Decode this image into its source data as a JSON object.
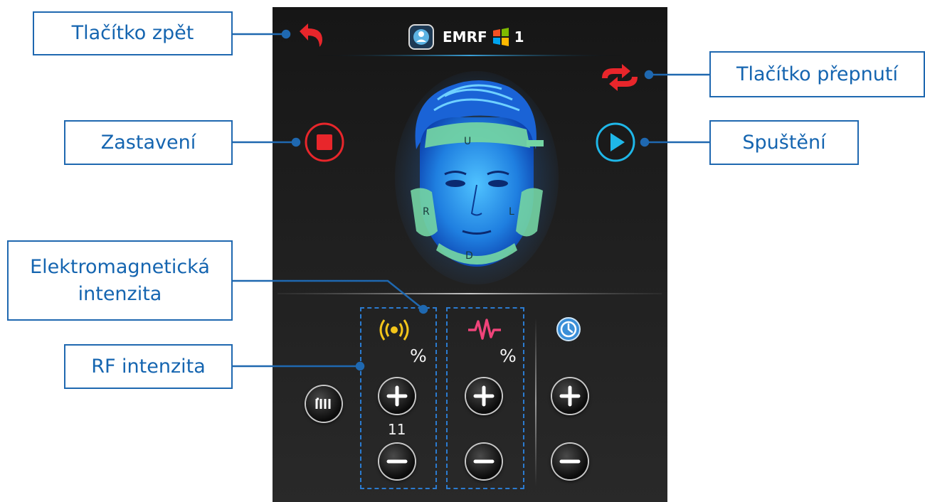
{
  "device": {
    "title_app": "EMRF",
    "title_number": "1"
  },
  "callouts": {
    "back": "Tlačítko zpět",
    "switch": "Tlačítko přepnutí",
    "stop": "Zastavení",
    "start": "Spuštění",
    "em_intensity_line1": "Elektromagnetická",
    "em_intensity_line2": "intenzita",
    "rf_intensity": "RF intenzita"
  },
  "face_zones": {
    "top": "U",
    "right": "R",
    "left": "L",
    "bottom": "D"
  },
  "controls": {
    "rf_unit": "%",
    "em_unit": "%",
    "rf_value": "11"
  },
  "icons": [
    "back-arrow-icon",
    "switch-arrows-icon",
    "stop-icon",
    "play-icon",
    "rf-antenna-icon",
    "em-wave-icon",
    "timer-icon",
    "mode-bars-icon",
    "plus-icon",
    "minus-icon"
  ],
  "colors": {
    "callout_border": "#1f68b0",
    "callout_text": "#1565b0",
    "stop_red": "#e8262b",
    "play_cyan": "#1fb7e8",
    "zone_green": "#74d5a3",
    "rf_yellow": "#f3c51a",
    "em_pink": "#f0447a"
  }
}
